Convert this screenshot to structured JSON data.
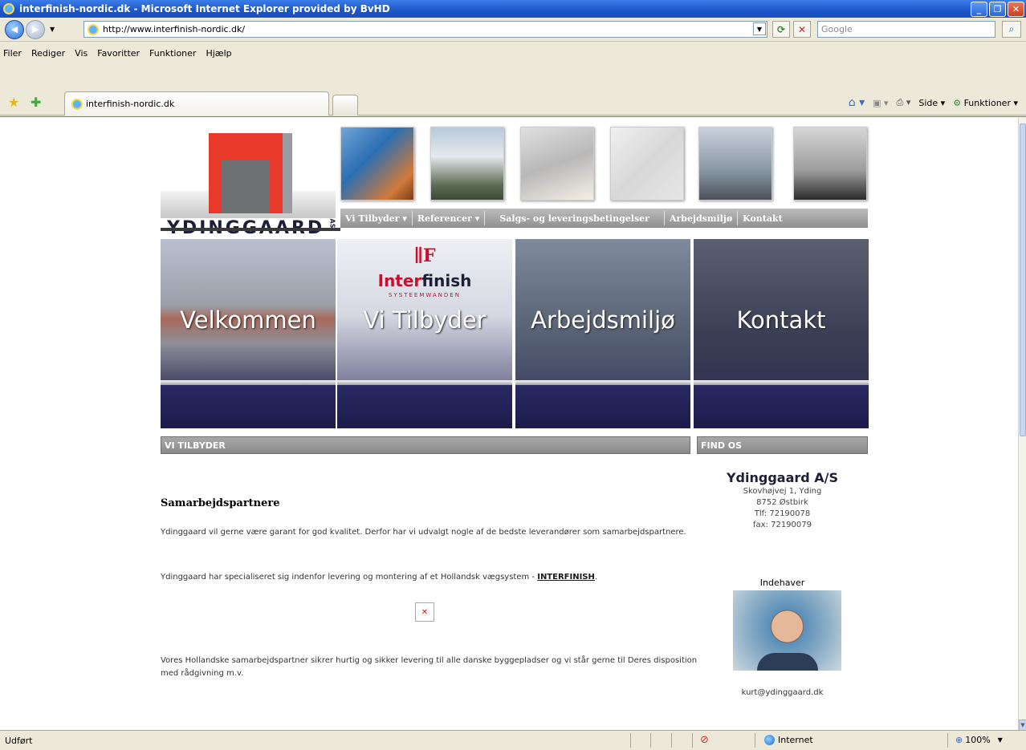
{
  "window": {
    "title": "interfinish-nordic.dk - Microsoft Internet Explorer provided by BvHD",
    "buttons": {
      "minimize": "_",
      "maximize": "❐",
      "close": "✕"
    }
  },
  "addressbar": {
    "url": "http://www.interfinish-nordic.dk/",
    "search_placeholder": "Google"
  },
  "menu": [
    "Filer",
    "Rediger",
    "Vis",
    "Favoritter",
    "Funktioner",
    "Hjælp"
  ],
  "tabs": {
    "active_label": "interfinish-nordic.dk"
  },
  "commandbar": {
    "page_label": "Side",
    "tools_label": "Funktioner"
  },
  "site": {
    "logo_text": "YDINGGAARD",
    "logo_suffix": "AS",
    "nav": [
      "Vi Tilbyder ▾",
      "Referencer ▾",
      "Salgs- og leveringsbetingelser",
      "Arbejdsmiljø",
      "Kontakt"
    ],
    "panels": [
      "Velkommen",
      "Vi Tilbyder",
      "Arbejdsmiljø",
      "Kontakt"
    ],
    "interfinish_logo": {
      "inter": "Inter",
      "finish": "finish",
      "sub": "SYSTEEMWANDEN"
    },
    "sections": {
      "left": "VI TILBYDER",
      "right": "FIND OS"
    },
    "content": {
      "title": "Samarbejdspartnere",
      "para1": "Ydinggaard vil gerne være garant for god kvalitet. Derfor har vi udvalgt nogle af de bedste leverandører som samarbejdspartnere.",
      "para2_prefix": "Ydinggaard har specialiseret sig indenfor levering og montering af et Hollandsk vægsystem - ",
      "para2_link": "INTERFINISH",
      "para2_suffix": ".",
      "para3": "Vores Hollandske samarbejdspartner sikrer hurtig og sikker levering til alle danske byggepladser og vi står gerne til Deres disposition med rådgivning m.v."
    },
    "company": {
      "name": "Ydinggaard A/S",
      "address1": "Skovhøjvej 1, Yding",
      "address2": "8752 Østbirk",
      "phone": "Tlf:   72190078",
      "fax": "fax:  72190079",
      "owner_label": "Indehaver",
      "email": "kurt@ydinggaard.dk"
    }
  },
  "statusbar": {
    "status": "Udført",
    "zone": "Internet",
    "zoom": "100%"
  }
}
